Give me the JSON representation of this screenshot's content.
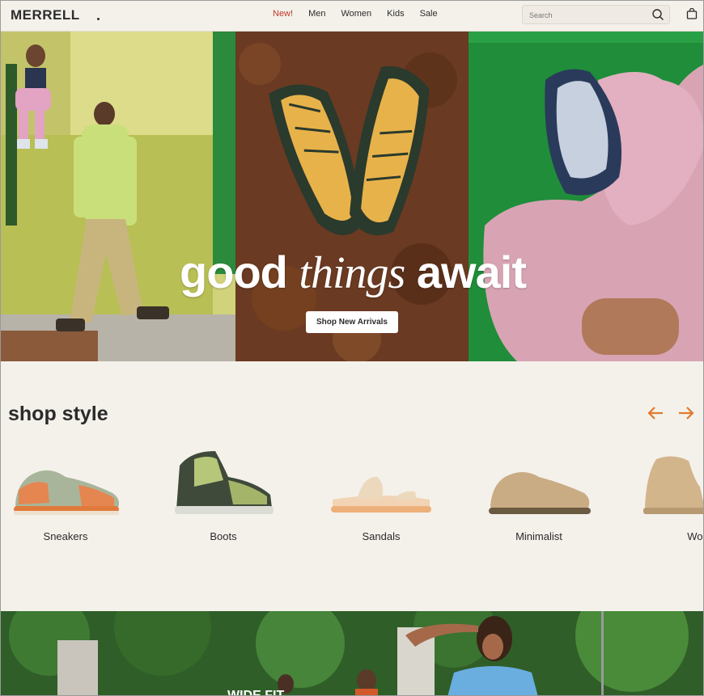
{
  "header": {
    "logo": "MERRELL",
    "nav": [
      "New!",
      "Men",
      "Women",
      "Kids",
      "Sale"
    ],
    "search_placeholder": "Search",
    "icons": [
      "search-icon",
      "shopping-bag-icon"
    ]
  },
  "hero": {
    "headline_1": "good",
    "headline_2": "things",
    "headline_3": "await",
    "cta": "Shop New Arrivals"
  },
  "shop_style": {
    "title": "shop style",
    "categories": [
      "Sneakers",
      "Boots",
      "Sandals",
      "Minimalist",
      "Wor"
    ]
  },
  "band": {
    "caption": "WIDE FIT"
  },
  "colors": {
    "background": "#f4f1eb",
    "accent": "#e07a2e",
    "new_link": "#c0392b"
  }
}
